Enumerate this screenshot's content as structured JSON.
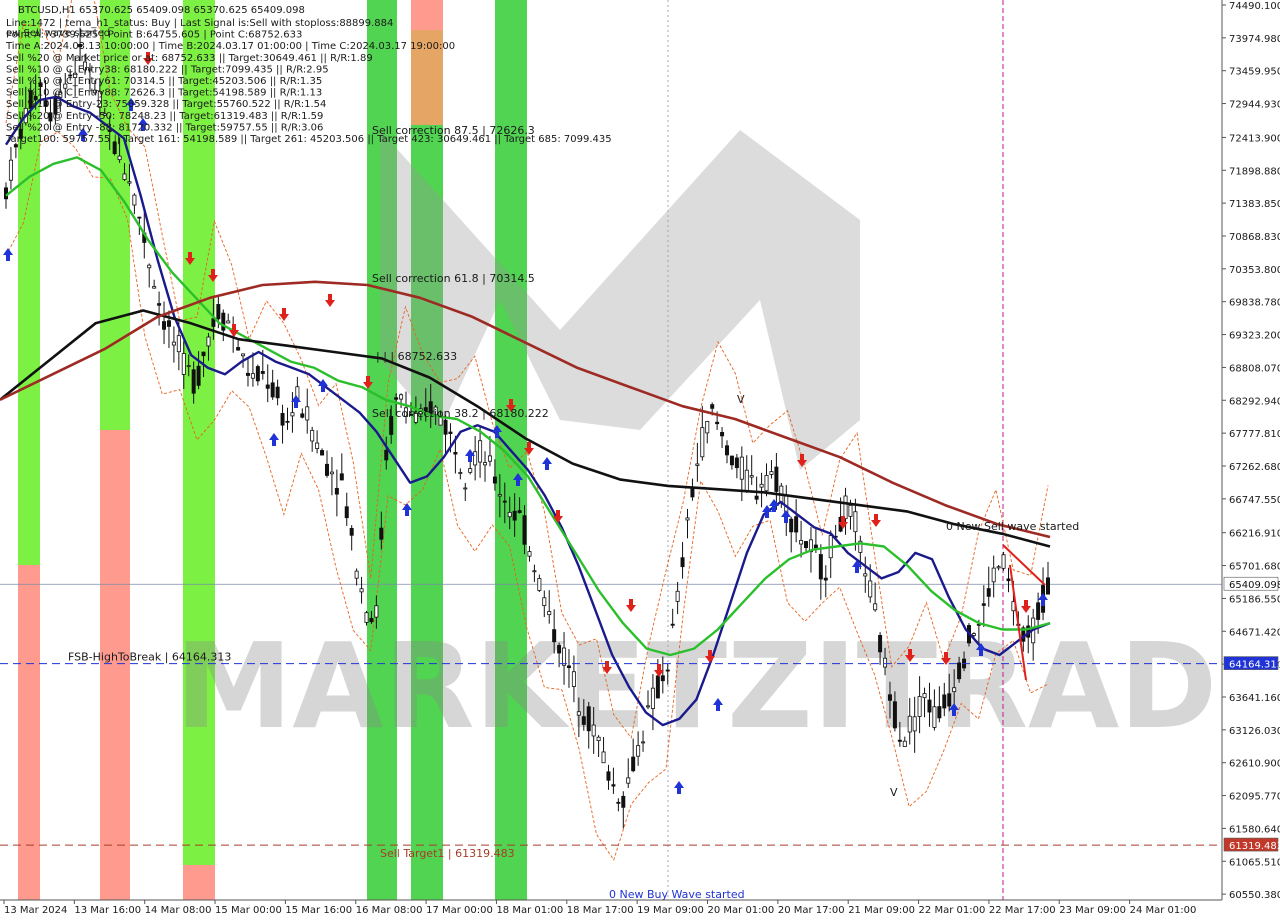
{
  "chart_data": {
    "type": "line",
    "symbol": "BTCUSD,H1",
    "ohlc_header": "BTCUSD,H1   65370.625 65409.098 65370.625 65409.098",
    "info_lines": [
      "Line:1472 | tema_h1_status: Buy | Last Signal is:Sell with stoploss:88899.884",
      "Point A:73739.625 | Point B:64755.605 | Point C:68752.633",
      "Time A:2024.03.13 10:00:00 | Time B:2024.03.17 01:00:00 | Time C:2024.03.17 19:00:00",
      "Sell %20 @ Market price or at: 68752.633 || Target:30649.461 || R/R:1.89",
      "Sell %10 @ C_Entry38: 68180.222 || Target:7099.435 || R/R:2.95",
      "Sell %10 @ C_Entry61: 70314.5 || Target:45203.506 || R/R:1.35",
      "Sell %10 @ C_Entry88: 72626.3 || Target:54198.589 || R/R:1.13",
      "Sell %10 @ Entry-23: 75859.328 || Target:55760.522 || R/R:1.54",
      "Sell %20 @ Entry -50: 78248.23 || Target:61319.483 || R/R:1.59",
      "Sell %20 @ Entry -88: 81720.332 || Target:59757.55 || R/R:3.06",
      "Target100: 59757.55 || Target 161: 54198.589 || Target 261: 45203.506 || Target 423: 30649.461 || Target 685: 7099.435"
    ],
    "info_overlay": "ew Sell wave started",
    "ylim": [
      60380,
      74490
    ],
    "y_ticks": [
      74490.0,
      73974.98,
      73459.95,
      72944.93,
      72413.9,
      71898.88,
      71383.85,
      70868.83,
      70353.8,
      69838.78,
      69323.2,
      68808.07,
      68292.94,
      67777.81,
      67262.68,
      66747.55,
      66216.91,
      65701.68,
      65186.55,
      64671.42,
      64156.29,
      63641.16,
      63126.03,
      62610.9,
      62095.77,
      61580.64,
      61065.51,
      60550.38
    ],
    "y_tick_labels": [
      "74490.100",
      "73974.980",
      "73459.950",
      "72944.930",
      "72413.900",
      "71898.880",
      "71383.850",
      "70868.830",
      "70353.800",
      "69838.780",
      "69323.200",
      "68808.070",
      "68292.940",
      "67777.810",
      "67262.680",
      "66747.550",
      "66216.910",
      "65701.680",
      "65186.550",
      "64671.420",
      "64156.290",
      "63641.160",
      "63126.030",
      "62610.900",
      "62095.770",
      "61580.640",
      "61065.510",
      "60550.380"
    ],
    "x_tick_labels": [
      "13 Mar 2024",
      "13 Mar 16:00",
      "14 Mar 08:00",
      "15 Mar 00:00",
      "15 Mar 16:00",
      "16 Mar 08:00",
      "17 Mar 00:00",
      "18 Mar 01:00",
      "18 Mar 17:00",
      "19 Mar 09:00",
      "20 Mar 01:00",
      "20 Mar 17:00",
      "21 Mar 09:00",
      "22 Mar 01:00",
      "22 Mar 17:00",
      "23 Mar 09:00",
      "24 Mar 01:00"
    ],
    "price_tags": [
      {
        "label": "65409.098",
        "value": 65409.098,
        "bg": "#ffffff",
        "fg": "#111111"
      },
      {
        "label": "64164.313",
        "value": 64164.313,
        "bg": "#1f33d6",
        "fg": "#ffffff"
      },
      {
        "label": "61319.483",
        "value": 61319.483,
        "bg": "#c0392b",
        "fg": "#ffffff"
      }
    ],
    "levels": [
      {
        "label": "FSB-HighToBreak | 64164.313",
        "value": 64164.313,
        "color": "#1f33d6"
      },
      {
        "label": "Sell Target1 | 61319.483",
        "value": 61319.483,
        "color": "#a83c2a"
      }
    ],
    "annotations": [
      {
        "text": "Sell correction 87.5 | 72626.3",
        "x_slot": 0.29,
        "value": 72626.3
      },
      {
        "text": "Sell correction 61.8 | 70314.5",
        "x_slot": 0.29,
        "value": 70314.5
      },
      {
        "text": "Sell correction 38.2 | 68180.222",
        "x_slot": 0.29,
        "value": 68180.222
      },
      {
        "text": "| | | 68752.633",
        "x_slot": 0.29,
        "value": 68752.633
      },
      {
        "text": "0 New Sell wave started",
        "x_slot": 0.74,
        "value": 66260
      },
      {
        "text": "0 New Buy Wave started",
        "x_slot": 0.48,
        "value": 60450
      },
      {
        "text": "V",
        "x_slot": 0.7,
        "value": 62130
      },
      {
        "text": "V",
        "x_slot": 0.58,
        "value": 68300
      }
    ],
    "watermark": "MARKETZITRADE",
    "colors": {
      "candles": "#111111",
      "tema": "#1a1a8c",
      "ma_green": "#2bbf2b",
      "ma_black": "#111111",
      "ma_brown": "#9e2a24",
      "channel": "#e8621c",
      "buy_arrow": "#1f33d6",
      "sell_arrow": "#e0201b",
      "zone_green": "#33cc33",
      "zone_lime": "#66ee22",
      "zone_salmon": "#ff8a7a",
      "zone_orange": "#e0954a",
      "vline_magenta": "#c2188f"
    },
    "series": [
      {
        "values": [
          71600,
          72300,
          72900,
          73300,
          72800,
          73200,
          73500,
          73700,
          73100,
          72600,
          72100,
          71800,
          71100,
          70300,
          69600,
          69200,
          68800,
          68600,
          69300,
          69700,
          69500,
          69000,
          68600,
          68700,
          68400,
          67900,
          68300,
          68000,
          67500,
          67200,
          67000,
          66000,
          65100,
          64800,
          67600,
          68400,
          68100,
          67900,
          68200,
          68000,
          67600,
          67200,
          67500,
          67300,
          66900,
          66600,
          66400,
          65800,
          65200,
          64600,
          64200,
          63700,
          63300,
          62900,
          62300,
          62000,
          62600,
          63200,
          63700,
          64100,
          65200,
          66600,
          67600,
          68100,
          67700,
          67300,
          67100,
          66900,
          67200,
          67000,
          66500,
          66100,
          65900,
          65600,
          66200,
          66600,
          66200,
          65400,
          64500,
          63600,
          63000,
          63300,
          63700,
          63300,
          63600,
          64100,
          64600,
          64800,
          65500,
          65800,
          65000,
          64400,
          64900,
          65400
        ]
      },
      {
        "name": "TEMA",
        "values": [
          72300,
          72700,
          73000,
          73050,
          72900,
          72800,
          72600,
          72400,
          71500,
          70500,
          69600,
          69000,
          68800,
          68700,
          68900,
          69050,
          68900,
          68800,
          68700,
          68500,
          68300,
          68100,
          67800,
          67400,
          67000,
          67100,
          67400,
          67800,
          67900,
          67800,
          67500,
          67200,
          66800,
          66300,
          65700,
          65000,
          64300,
          63800,
          63400,
          63200,
          63300,
          63600,
          64300,
          65100,
          65900,
          66500,
          66700,
          66500,
          66300,
          66200,
          65900,
          65700,
          65500,
          65600,
          65900,
          65800,
          65200,
          64700,
          64400,
          64300,
          64500,
          64700,
          64800
        ]
      },
      {
        "name": "MA green",
        "values": [
          71500,
          71800,
          72000,
          72100,
          71900,
          71400,
          70800,
          70300,
          69900,
          69500,
          69300,
          69100,
          68900,
          68800,
          68600,
          68500,
          68300,
          68200,
          68050,
          68000,
          67800,
          67500,
          67100,
          66500,
          65900,
          65300,
          64800,
          64400,
          64300,
          64400,
          64700,
          65100,
          65500,
          65800,
          65950,
          66000,
          66050,
          66000,
          65700,
          65300,
          65000,
          64800,
          64700,
          64700,
          64800
        ]
      },
      {
        "name": "MA black",
        "values": [
          68300,
          68900,
          69500,
          69700,
          69500,
          69250,
          69150,
          69050,
          68950,
          68650,
          68200,
          67700,
          67300,
          67050,
          66950,
          66900,
          66850,
          66750,
          66650,
          66550,
          66350,
          66200,
          66000
        ]
      },
      {
        "name": "MA brown",
        "values": [
          68300,
          68700,
          69100,
          69600,
          69900,
          70100,
          70150,
          70100,
          69900,
          69600,
          69200,
          68800,
          68500,
          68200,
          68000,
          67700,
          67400,
          67000,
          66650,
          66350,
          66150
        ]
      }
    ]
  }
}
